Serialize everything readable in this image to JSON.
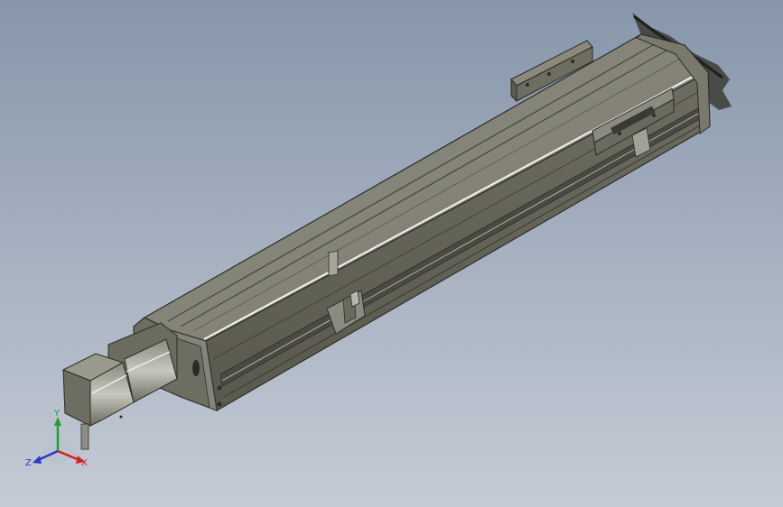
{
  "viewport": {
    "background_top": "#8796ab",
    "background_bottom": "#c4cbd5"
  },
  "model": {
    "body_color": "#7d7c6e",
    "top_color": "#8e8d80",
    "edge_color": "#2d2d28",
    "highlight_color": "#f2f2ee"
  },
  "triad": {
    "x_label": "X",
    "y_label": "Y",
    "z_label": "Z",
    "x_color": "#d42020",
    "y_color": "#1fa02a",
    "z_color": "#2b38c8"
  }
}
